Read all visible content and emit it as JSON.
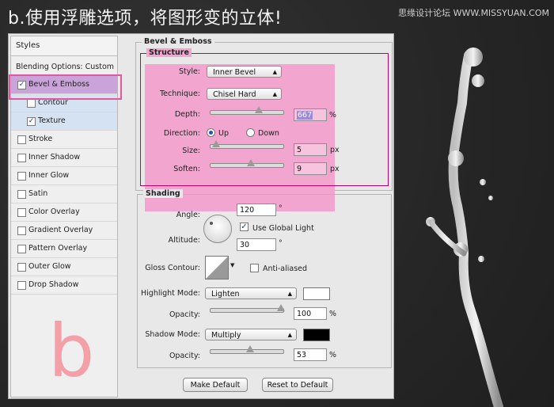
{
  "header": {
    "title": "b.使用浮雕选项，将图形变的立体!",
    "watermark": "思缘设计论坛 WWW.MISSYUAN.COM"
  },
  "styles_panel": {
    "heading": "Styles",
    "blending_options": "Blending Options: Custom",
    "items": [
      {
        "label": "Bevel & Emboss",
        "checked": true,
        "active": true,
        "sub": false
      },
      {
        "label": "Contour",
        "checked": false,
        "sub": true
      },
      {
        "label": "Texture",
        "checked": true,
        "sub": true
      },
      {
        "label": "Stroke",
        "checked": false,
        "sub": false
      },
      {
        "label": "Inner Shadow",
        "checked": false,
        "sub": false
      },
      {
        "label": "Inner Glow",
        "checked": false,
        "sub": false
      },
      {
        "label": "Satin",
        "checked": false,
        "sub": false
      },
      {
        "label": "Color Overlay",
        "checked": false,
        "sub": false
      },
      {
        "label": "Gradient Overlay",
        "checked": false,
        "sub": false
      },
      {
        "label": "Pattern Overlay",
        "checked": false,
        "sub": false
      },
      {
        "label": "Outer Glow",
        "checked": false,
        "sub": false
      },
      {
        "label": "Drop Shadow",
        "checked": false,
        "sub": false
      }
    ],
    "overlay_letter": "b"
  },
  "bevel": {
    "title": "Bevel & Emboss",
    "structure_title": "Structure",
    "style_label": "Style:",
    "style_value": "Inner Bevel",
    "technique_label": "Technique:",
    "technique_value": "Chisel Hard",
    "depth_label": "Depth:",
    "depth_value": "667",
    "depth_unit": "%",
    "depth_level": 0.67,
    "direction_label": "Direction:",
    "direction_up": "Up",
    "direction_down": "Down",
    "size_label": "Size:",
    "size_value": "5",
    "size_unit": "px",
    "size_level": 0.02,
    "soften_label": "Soften:",
    "soften_value": "9",
    "soften_unit": "px",
    "soften_level": 0.55
  },
  "shading": {
    "title": "Shading",
    "angle_label": "Angle:",
    "angle_value": "120",
    "angle_unit": "°",
    "global_light_label": "Use Global Light",
    "altitude_label": "Altitude:",
    "altitude_value": "30",
    "altitude_unit": "°",
    "gloss_label": "Gloss Contour:",
    "anti_aliased_label": "Anti-aliased",
    "highlight_mode_label": "Highlight Mode:",
    "highlight_mode_value": "Lighten",
    "highlight_color": "#ffffff",
    "highlight_opacity_label": "Opacity:",
    "highlight_opacity_value": "100",
    "highlight_opacity_unit": "%",
    "highlight_opacity_level": 1.0,
    "shadow_mode_label": "Shadow Mode:",
    "shadow_mode_value": "Multiply",
    "shadow_color": "#000000",
    "shadow_opacity_label": "Opacity:",
    "shadow_opacity_value": "53",
    "shadow_opacity_unit": "%",
    "shadow_opacity_level": 0.53
  },
  "buttons": {
    "make_default": "Make Default",
    "reset_default": "Reset to Default"
  }
}
